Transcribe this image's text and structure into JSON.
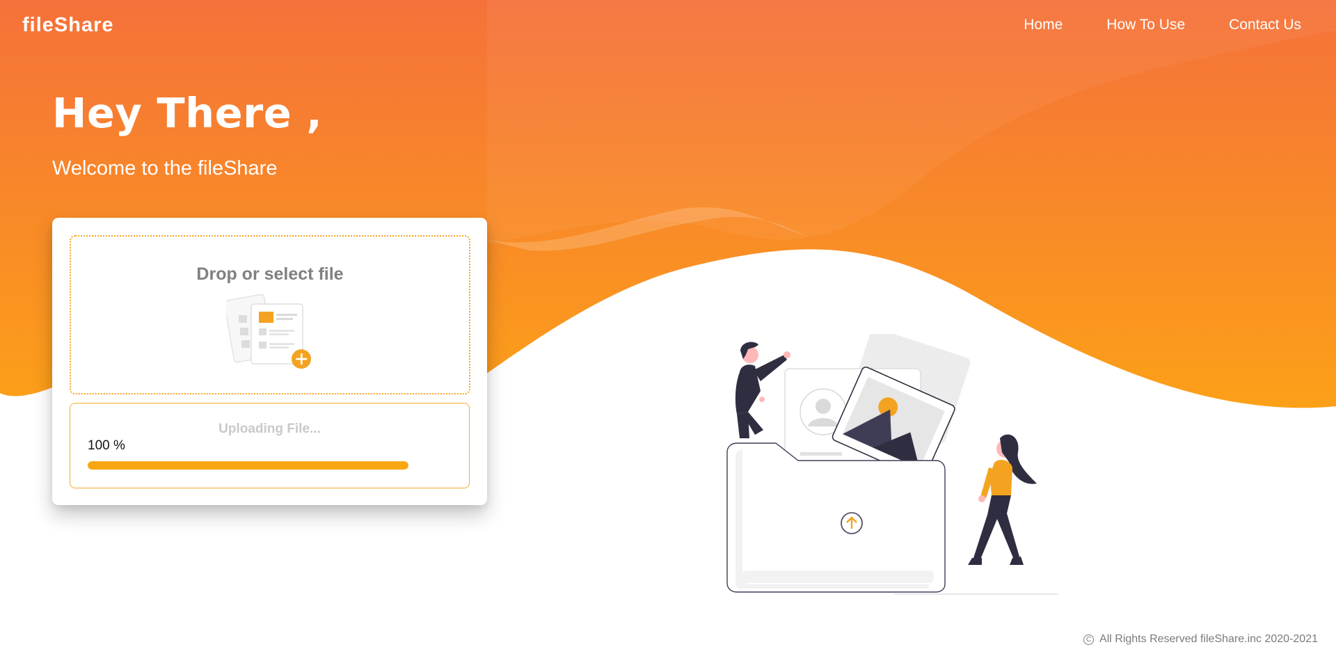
{
  "brand": {
    "name": "fileShare"
  },
  "nav": {
    "items": [
      "Home",
      "How To Use",
      "Contact Us"
    ]
  },
  "hero": {
    "title": "Hey There ,",
    "subtitle": "Welcome to the fileShare"
  },
  "upload_card": {
    "drop_label": "Drop or select file",
    "status_label": "Uploading File...",
    "percent_label": "100 %",
    "progress_percent": 100
  },
  "footer": {
    "copyright_symbol": "C",
    "text": "All Rights Reserved fileShare.inc 2020-2021"
  },
  "colors": {
    "gradient_top": "#f5713a",
    "gradient_bottom": "#fca018",
    "accent": "#f8a613",
    "text_muted": "#808080"
  },
  "icons": {
    "drop_illustration": "file-add-icon",
    "hero_illustration": "people-upload-folder-illustration",
    "copyright": "copyright-icon"
  }
}
